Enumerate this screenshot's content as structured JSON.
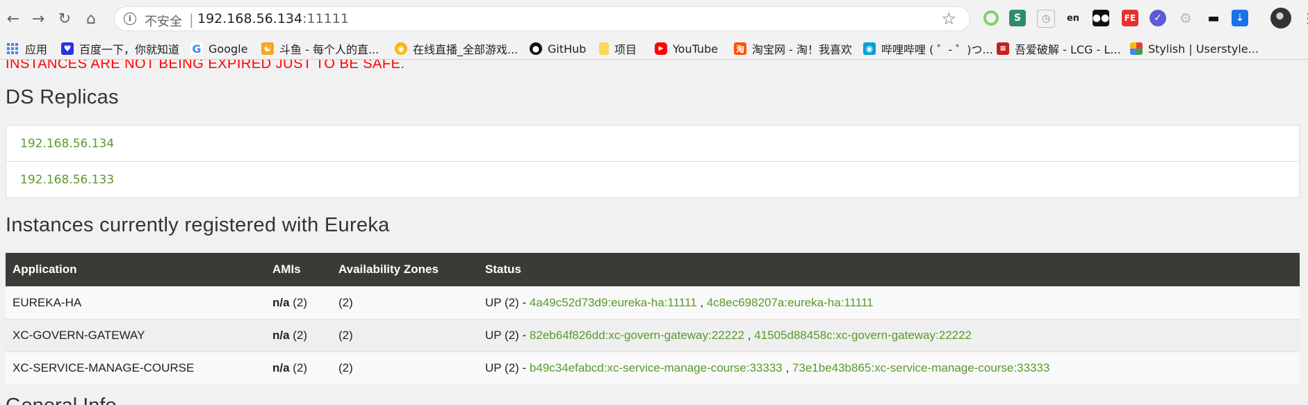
{
  "browser": {
    "url_insecure_label": "不安全",
    "url_separator": "|",
    "url_host": "192.168.56.134",
    "url_port": ":11111",
    "extensions": [
      "green-ring-icon",
      "s-ext-icon",
      "gauge-icon",
      "en-translate-icon",
      "tampermonkey-icon",
      "fe-ext-icon",
      "check-circle-icon",
      "gear-ext-icon",
      "sunglasses-icon",
      "download-ext-icon"
    ],
    "ext_labels": {
      "s": "S",
      "fe": "FE",
      "en": "en"
    }
  },
  "bookmarks": [
    {
      "label": "应用",
      "icon": "apps-icon"
    },
    {
      "label": "百度一下，你就知道",
      "icon": "baidu-icon"
    },
    {
      "label": "Google",
      "icon": "google-icon"
    },
    {
      "label": "斗鱼 - 每个人的直...",
      "icon": "douyu-icon"
    },
    {
      "label": "在线直播_全部游戏...",
      "icon": "huya-icon"
    },
    {
      "label": "GitHub",
      "icon": "github-icon"
    },
    {
      "label": "项目",
      "icon": "folder-icon"
    },
    {
      "label": "YouTube",
      "icon": "youtube-icon"
    },
    {
      "label": "淘宝网 - 淘！我喜欢",
      "icon": "taobao-icon"
    },
    {
      "label": "哔哩哔哩 ( ゜- ゜)つ...",
      "icon": "bilibili-icon"
    },
    {
      "label": "吾爱破解 - LCG - L...",
      "icon": "52pojie-icon"
    },
    {
      "label": "Stylish | Userstyle...",
      "icon": "stylish-icon"
    }
  ],
  "page": {
    "warning": "INSTANCES ARE NOT BEING EXPIRED JUST TO BE SAFE.",
    "replicas_title": "DS Replicas",
    "replicas": [
      "192.168.56.134",
      "192.168.56.133"
    ],
    "instances_title": "Instances currently registered with Eureka",
    "table": {
      "headers": [
        "Application",
        "AMIs",
        "Availability Zones",
        "Status"
      ],
      "rows": [
        {
          "app": "EUREKA-HA",
          "ami_na": "n/a",
          "ami_count": " (2)",
          "zones": "(2)",
          "status": "UP (2) - ",
          "links": [
            "4a49c52d73d9:eureka-ha:11111",
            "4c8ec698207a:eureka-ha:11111"
          ]
        },
        {
          "app": "XC-GOVERN-GATEWAY",
          "ami_na": "n/a",
          "ami_count": " (2)",
          "zones": "(2)",
          "status": "UP (2) - ",
          "links": [
            "82eb64f826dd:xc-govern-gateway:22222",
            "41505d88458c:xc-govern-gateway:22222"
          ]
        },
        {
          "app": "XC-SERVICE-MANAGE-COURSE",
          "ami_na": "n/a",
          "ami_count": " (2)",
          "zones": "(2)",
          "status": "UP (2) - ",
          "links": [
            "b49c34efabcd:xc-service-manage-course:33333",
            "73e1be43b865:xc-service-manage-course:33333"
          ]
        }
      ],
      "link_separator": " , "
    },
    "next_section_partial": "General Info"
  },
  "colors": {
    "link": "#5a9a2a",
    "warning": "#ff0000",
    "table_header": "#3c3a36"
  }
}
